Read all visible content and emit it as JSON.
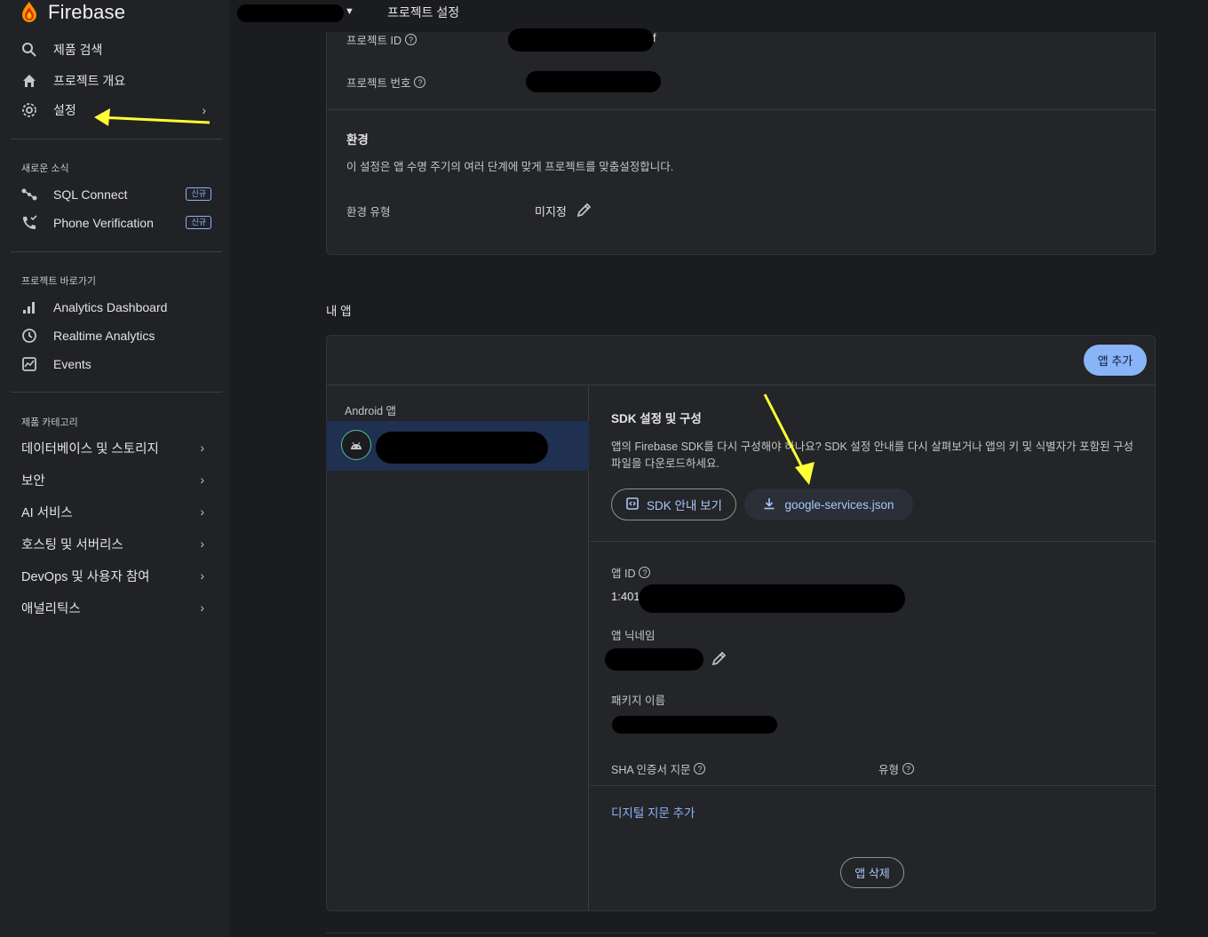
{
  "brand": {
    "name": "Firebase"
  },
  "sidebar": {
    "items": [
      {
        "label": "제품 검색",
        "icon": "search-icon"
      },
      {
        "label": "프로젝트 개요",
        "icon": "home-icon"
      },
      {
        "label": "설정",
        "icon": "gear-icon"
      }
    ],
    "news_title": "새로운 소식",
    "news": [
      {
        "label": "SQL Connect",
        "badge": "신규",
        "icon": "sql-connect-icon"
      },
      {
        "label": "Phone Verification",
        "badge": "신규",
        "icon": "phone-verification-icon"
      }
    ],
    "shortcuts_title": "프로젝트 바로가기",
    "shortcuts": [
      {
        "label": "Analytics Dashboard",
        "icon": "bar-chart-icon"
      },
      {
        "label": "Realtime Analytics",
        "icon": "clock-icon"
      },
      {
        "label": "Events",
        "icon": "events-icon"
      }
    ],
    "categories_title": "제품 카테고리",
    "categories": [
      {
        "label": "데이터베이스 및 스토리지"
      },
      {
        "label": "보안"
      },
      {
        "label": "AI 서비스"
      },
      {
        "label": "호스팅 및 서버리스"
      },
      {
        "label": "DevOps 및 사용자 참여"
      },
      {
        "label": "애널리틱스"
      }
    ]
  },
  "topbar": {
    "breadcrumb": "프로젝트 설정"
  },
  "project": {
    "id_label": "프로젝트 ID",
    "id_visible_suffix": "f",
    "number_label": "프로젝트 번호"
  },
  "environment": {
    "title": "환경",
    "description": "이 설정은 앱 수명 주기의 여러 단계에 맞게 프로젝트를 맞춤설정합니다.",
    "type_label": "환경 유형",
    "type_value": "미지정"
  },
  "my_apps": {
    "title": "내 앱",
    "add_app_label": "앱 추가",
    "android_header": "Android 앱",
    "sdk": {
      "title": "SDK 설정 및 구성",
      "description": "앱의 Firebase SDK를 다시 구성해야 하나요? SDK 설정 안내를 다시 살펴보거나 앱의 키 및 식별자가 포함된 구성 파일을 다운로드하세요.",
      "guide_button": "SDK 안내 보기",
      "download_button": "google-services.json"
    },
    "app_id_label": "앱 ID",
    "app_id_visible_prefix": "1:401",
    "nickname_label": "앱 닉네임",
    "package_label": "패키지 이름",
    "sha_label": "SHA 인증서 지문",
    "type_label": "유형",
    "add_fingerprint": "디지털 지문 추가",
    "delete_app": "앱 삭제"
  },
  "colors": {
    "accent": "#8ab4f8",
    "annotation_arrow": "#ffff33"
  }
}
